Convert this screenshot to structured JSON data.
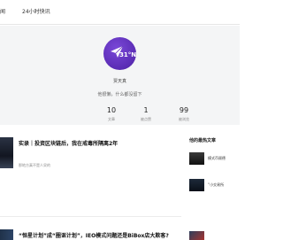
{
  "nav": {
    "news": "闻",
    "flash": "24小时快讯"
  },
  "profile": {
    "avatar_text": "31°N",
    "name": "贾天真",
    "bio": "他很懒，什么都没留下"
  },
  "stats": [
    {
      "value": "10",
      "label": "文章"
    },
    {
      "value": "1",
      "label": "被点赞"
    },
    {
      "value": "99",
      "label": "被浏览"
    }
  ],
  "articles": [
    {
      "title": "实录｜投资区块链后，我在戒毒所隔离2年",
      "summary": "那地方真不是人呆的"
    },
    {
      "title": "“恒星计划”成“圈诓计划”，IEO模式问题还是BiBox店大欺客?"
    }
  ],
  "sidebar": {
    "heading": "他的最热文章",
    "items": [
      {
        "title": "模式币顾德"
      },
      {
        "title": "“小交易所"
      },
      {
        "title": ""
      }
    ]
  }
}
